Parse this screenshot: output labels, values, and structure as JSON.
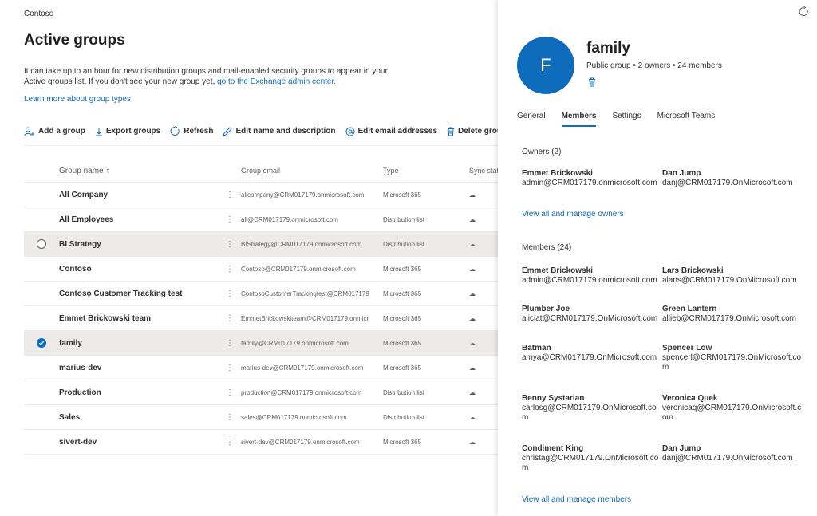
{
  "breadcrumb": "Contoso",
  "page_title": "Active groups",
  "intro": {
    "text": "It can take up to an hour for new distribution groups and mail-enabled security groups to appear in your Active groups list. If you don't see your new group yet, ",
    "link": "go to the Exchange admin center."
  },
  "learn_more": "Learn more about group types",
  "commands": {
    "add": "Add a group",
    "export": "Export groups",
    "refresh": "Refresh",
    "edit_name": "Edit name and description",
    "edit_email": "Edit email addresses",
    "delete": "Delete group"
  },
  "table": {
    "headers": {
      "name": "Group name ↑",
      "email": "Group email",
      "type": "Type",
      "sync": "Sync statu"
    },
    "rows": [
      {
        "name": "All Company",
        "email": "allcompany@CRM017179.onmicrosoft.com",
        "type": "Microsoft 365"
      },
      {
        "name": "All Employees",
        "email": "all@CRM017179.onmicrosoft.com",
        "type": "Distribution list"
      },
      {
        "name": "BI Strategy",
        "email": "BIStrategy@CRM017179.onmicrosoft.com",
        "type": "Distribution list"
      },
      {
        "name": "Contoso",
        "email": "Contoso@CRM017179.onmicrosoft.com",
        "type": "Microsoft 365"
      },
      {
        "name": "Contoso Customer Tracking test",
        "email": "ContosoCustomerTrackingtest@CRM017179",
        "type": "Microsoft 365"
      },
      {
        "name": "Emmet Brickowski team",
        "email": "EmmetBrickowskiteam@CRM017179.onmicr",
        "type": "Microsoft 365"
      },
      {
        "name": "family",
        "email": "family@CRM017179.onmicrosoft.com",
        "type": "Microsoft 365"
      },
      {
        "name": "marius-dev",
        "email": "marius-dev@CRM017179.onmicrosoft.com",
        "type": "Microsoft 365"
      },
      {
        "name": "Production",
        "email": "production@CRM017179.onmicrosoft.com",
        "type": "Distribution list"
      },
      {
        "name": "Sales",
        "email": "sales@CRM017179.onmicrosoft.com",
        "type": "Distribution list"
      },
      {
        "name": "sivert-dev",
        "email": "sivert-dev@CRM017179.onmicrosoft.com",
        "type": "Microsoft 365"
      }
    ]
  },
  "panel": {
    "avatar_letter": "F",
    "group_name": "family",
    "meta": "Public group  • 2 owners  • 24 members",
    "tabs": [
      "General",
      "Members",
      "Settings",
      "Microsoft Teams"
    ],
    "owners_title": "Owners (2)",
    "owners": [
      {
        "name": "Emmet Brickowski",
        "email": "admin@CRM017179.onmicrosoft.com"
      },
      {
        "name": "Dan Jump",
        "email": "danj@CRM017179.OnMicrosoft.com"
      }
    ],
    "owners_link": "View all and manage owners",
    "members_title": "Members (24)",
    "members": [
      {
        "name": "Emmet Brickowski",
        "email": "admin@CRM017179.onmicrosoft.com"
      },
      {
        "name": "Lars Brickowski",
        "email": "alans@CRM017179.OnMicrosoft.com"
      },
      {
        "name": "Plumber Joe",
        "email": "aliciat@CRM017179.OnMicrosoft.com"
      },
      {
        "name": "Green Lantern",
        "email": "allieb@CRM017179.OnMicrosoft.com"
      },
      {
        "name": "Batman",
        "email": "amya@CRM017179.OnMicrosoft.com"
      },
      {
        "name": "Spencer Low",
        "email": "spencerl@CRM017179.OnMicrosoft.com"
      },
      {
        "name": "Benny Systarian",
        "email": "carlosg@CRM017179.OnMicrosoft.com"
      },
      {
        "name": "Veronica Quek",
        "email": "veronicaq@CRM017179.OnMicrosoft.com"
      },
      {
        "name": "Condiment King",
        "email": "christag@CRM017179.OnMicrosoft.com"
      },
      {
        "name": "Dan Jump",
        "email": "danj@CRM017179.OnMicrosoft.com"
      }
    ],
    "members_link": "View all and manage members"
  }
}
